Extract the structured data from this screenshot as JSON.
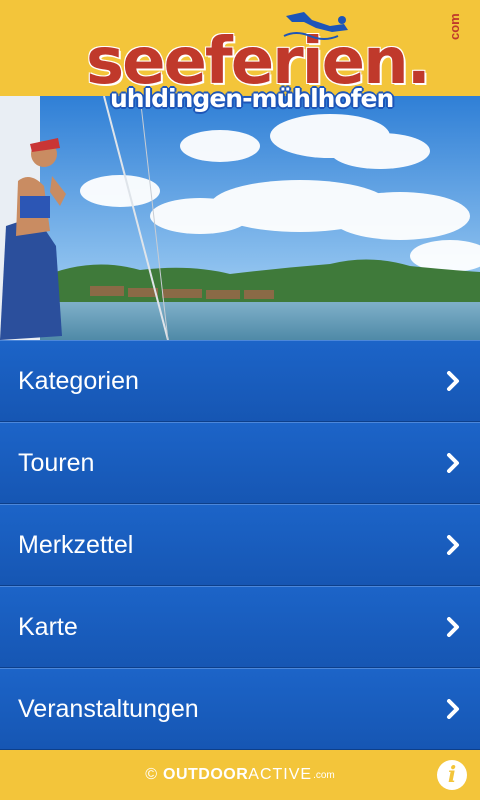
{
  "header": {
    "logo_main": "seeferien",
    "logo_dot": ".",
    "logo_com": "com",
    "logo_sub": "uhldingen-mühlhofen"
  },
  "menu": {
    "items": [
      {
        "label": "Kategorien"
      },
      {
        "label": "Touren"
      },
      {
        "label": "Merkzettel"
      },
      {
        "label": "Karte"
      },
      {
        "label": "Veranstaltungen"
      }
    ]
  },
  "footer": {
    "copyright": "©",
    "brand_bold": "OUTDOOR",
    "brand_light": "ACTIVE",
    "brand_suffix": ".com",
    "info_label": "i"
  },
  "colors": {
    "header_bg": "#f3c53a",
    "logo_red": "#c0392b",
    "logo_blue": "#1d55b8",
    "menu_blue": "#1c64c8"
  }
}
